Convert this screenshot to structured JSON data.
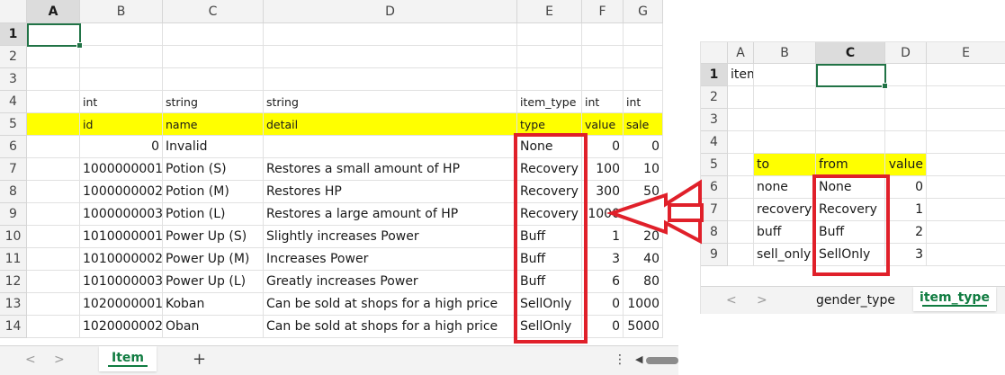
{
  "left_sheet": {
    "column_headers": [
      "A",
      "B",
      "C",
      "D",
      "E",
      "F",
      "G"
    ],
    "row_headers": [
      "1",
      "2",
      "3",
      "4",
      "5",
      "6",
      "7",
      "8",
      "9",
      "10",
      "11",
      "12",
      "13",
      "14"
    ],
    "rows": [
      [
        "",
        "",
        "",
        "",
        "",
        "",
        ""
      ],
      [
        "",
        "",
        "",
        "",
        "",
        "",
        ""
      ],
      [
        "",
        "",
        "",
        "",
        "",
        "",
        ""
      ],
      [
        "",
        "int",
        "string",
        "string",
        "item_type",
        "int",
        "int"
      ],
      [
        "",
        "id",
        "name",
        "detail",
        "type",
        "value",
        "sale"
      ],
      [
        "",
        "0",
        "Invalid",
        "",
        "None",
        "0",
        "0"
      ],
      [
        "",
        "1000000001",
        "Potion (S)",
        "Restores a small amount of HP",
        "Recovery",
        "100",
        "10"
      ],
      [
        "",
        "1000000002",
        "Potion (M)",
        "Restores HP",
        "Recovery",
        "300",
        "50"
      ],
      [
        "",
        "1000000003",
        "Potion (L)",
        "Restores a large amount of HP",
        "Recovery",
        "1000",
        "100"
      ],
      [
        "",
        "1010000001",
        "Power Up (S)",
        "Slightly increases Power",
        "Buff",
        "1",
        "20"
      ],
      [
        "",
        "1010000002",
        "Power Up (M)",
        "Increases Power",
        "Buff",
        "3",
        "40"
      ],
      [
        "",
        "1010000003",
        "Power Up (L)",
        "Greatly increases Power",
        "Buff",
        "6",
        "80"
      ],
      [
        "",
        "1020000001",
        "Koban",
        "Can be sold at shops for a high price",
        "SellOnly",
        "0",
        "1000"
      ],
      [
        "",
        "1020000002",
        "Oban",
        "Can be sold at shops for a high price",
        "SellOnly",
        "0",
        "5000"
      ]
    ],
    "tabs": {
      "prev": "<",
      "next": ">",
      "active": "Item",
      "add": "+",
      "more": "⋮"
    }
  },
  "right_sheet": {
    "column_headers": [
      "A",
      "B",
      "C",
      "D",
      "E"
    ],
    "row_headers": [
      "1",
      "2",
      "3",
      "4",
      "5",
      "6",
      "7",
      "8",
      "9"
    ],
    "rows": [
      [
        "item_type",
        "",
        "",
        "",
        ""
      ],
      [
        "",
        "",
        "",
        "",
        ""
      ],
      [
        "",
        "",
        "",
        "",
        ""
      ],
      [
        "",
        "",
        "",
        "",
        ""
      ],
      [
        "",
        "to",
        "from",
        "value",
        ""
      ],
      [
        "",
        "none",
        "None",
        "0",
        ""
      ],
      [
        "",
        "recovery",
        "Recovery",
        "1",
        ""
      ],
      [
        "",
        "buff",
        "Buff",
        "2",
        ""
      ],
      [
        "",
        "sell_only",
        "SellOnly",
        "3",
        ""
      ]
    ],
    "tabs": {
      "prev": "<",
      "next": ">",
      "inactive": "gender_type",
      "active": "item_type"
    }
  },
  "colors": {
    "highlight": "#ffff00",
    "annotation_red": "#e0202a",
    "excel_green": "#217346"
  }
}
